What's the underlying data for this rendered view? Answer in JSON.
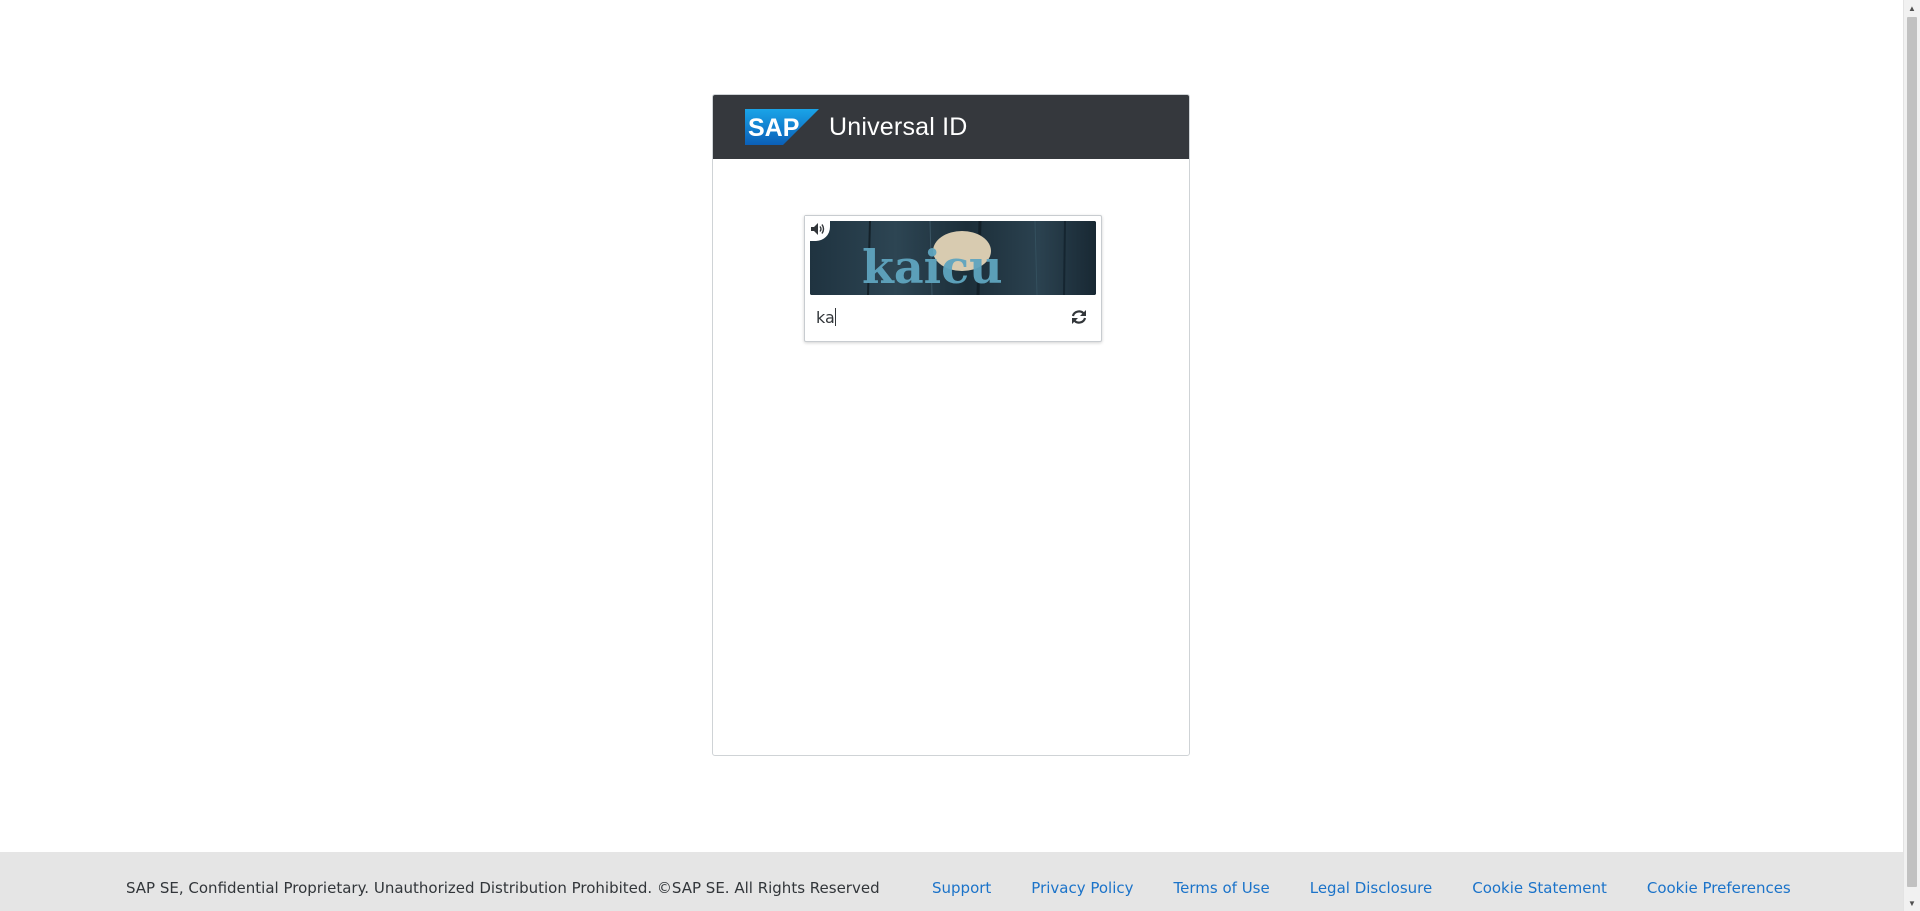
{
  "header": {
    "logo_text": "SAP",
    "title": "Universal ID"
  },
  "captcha": {
    "image_text": "kaicu",
    "input_value": "ka",
    "audio_icon": "speaker-icon",
    "refresh_icon": "refresh-icon"
  },
  "footer": {
    "copyright": "SAP SE, Confidential Proprietary. Unauthorized Distribution Prohibited. ©SAP SE. All Rights Reserved",
    "links": {
      "support": "Support",
      "privacy": "Privacy Policy",
      "terms": "Terms of Use",
      "legal": "Legal Disclosure",
      "cookie_statement": "Cookie Statement",
      "cookie_prefs": "Cookie Preferences"
    }
  },
  "colors": {
    "header_bg": "#35383d",
    "link": "#1b73c9",
    "footer_bg": "#e5e5e5",
    "sap_blue": "#0a6ed1"
  }
}
